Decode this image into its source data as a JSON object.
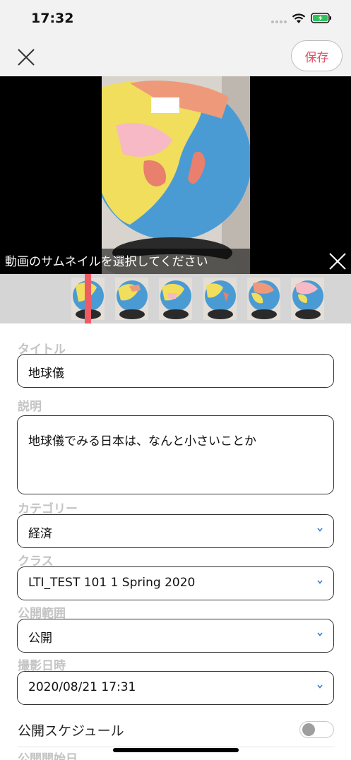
{
  "status_bar": {
    "time": "17:32"
  },
  "nav": {
    "save_label": "保存",
    "close_icon": "close-icon"
  },
  "video": {
    "thumbnail_caption": "動画のサムネイルを選択してください"
  },
  "form": {
    "title": {
      "label": "タイトル",
      "value": "地球儀"
    },
    "description": {
      "label": "説明",
      "value": "地球儀でみる日本は、なんと小さいことか"
    },
    "category": {
      "label": "カテゴリー",
      "value": "経済"
    },
    "class": {
      "label": "クラス",
      "value": "LTI_TEST 101 1 Spring 2020"
    },
    "visibility": {
      "label": "公開範囲",
      "value": "公開"
    },
    "shot_datetime": {
      "label": "撮影日時",
      "value": "2020/08/21 17:31"
    },
    "schedule": {
      "label": "公開スケジュール",
      "enabled": false
    },
    "publish_start": {
      "label": "公開開始日"
    }
  },
  "colors": {
    "accent": "#e0556a",
    "marker": "#ef5b64",
    "chevron": "#2e7fd9"
  }
}
